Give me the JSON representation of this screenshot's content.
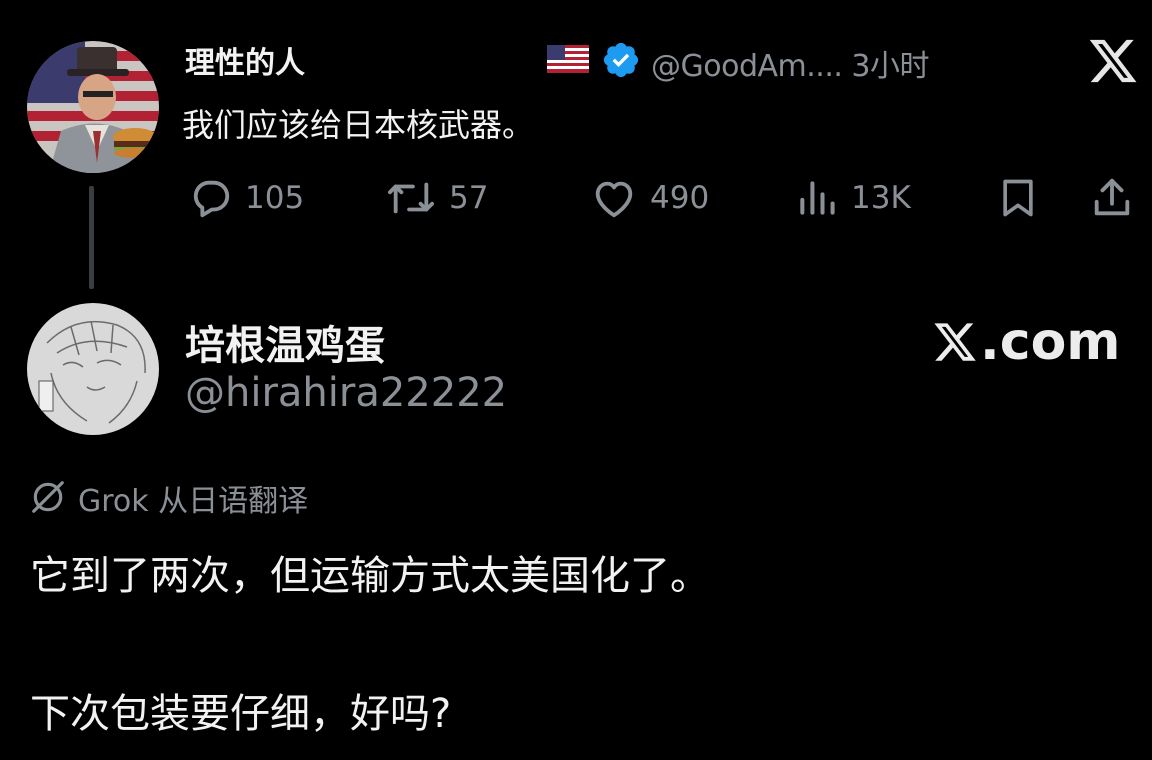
{
  "parent_tweet": {
    "author_name": "理性的人",
    "flag_icon": "us-flag-icon",
    "verified_icon": "verified-badge-icon",
    "handle_time": "@GoodAm.... 3小时",
    "text": "我们应该给日本核武器。",
    "actions": {
      "replies": "105",
      "retweets": "57",
      "likes": "490",
      "views": "13K"
    }
  },
  "reply": {
    "author_name": "培根温鸡蛋",
    "handle": "@hirahira22222",
    "watermark": ".com",
    "translation_label": "Grok 从日语翻译",
    "paragraphs": [
      "它到了两次，但运输方式太美国化了。",
      "下次包装要仔细，好吗?"
    ]
  },
  "colors": {
    "background": "#000000",
    "primary_text": "#f2f2f2",
    "secondary_text": "#8b9097",
    "verified_blue": "#1d9bf0"
  }
}
